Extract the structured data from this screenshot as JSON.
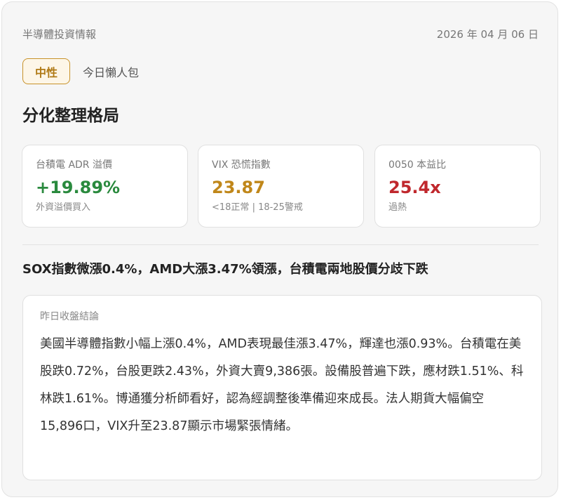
{
  "header": {
    "source": "半導體投資情報",
    "date": "2026 年 04 月 06 日"
  },
  "tag": {
    "sentiment": "中性",
    "label": "今日懶人包"
  },
  "headline": "分化整理格局",
  "metrics": [
    {
      "label": "台積電 ADR 溢價",
      "value": "+19.89%",
      "note": "外資溢價買入",
      "color": "#2a8a3e"
    },
    {
      "label": "VIX 恐慌指數",
      "value": "23.87",
      "note": "<18正常 | 18-25警戒",
      "color": "#c0871a"
    },
    {
      "label": "0050 本益比",
      "value": "25.4x",
      "note": "過熱",
      "color": "#c0282d"
    }
  ],
  "summary_title": "SOX指數微漲0.4%，AMD大漲3.47%領漲，台積電兩地股價分歧下跌",
  "conclusion": {
    "label": "昨日收盤結論",
    "body": "美國半導體指數小幅上漲0.4%，AMD表現最佳漲3.47%，輝達也漲0.93%。台積電在美股跌0.72%，台股更跌2.43%，外資大賣9,386張。設備股普遍下跌，應材跌1.51%、科林跌1.61%。博通獲分析師看好，認為經調整後準備迎來成長。法人期貨大幅偏空15,896口，VIX升至23.87顯示市場緊張情緒。"
  }
}
